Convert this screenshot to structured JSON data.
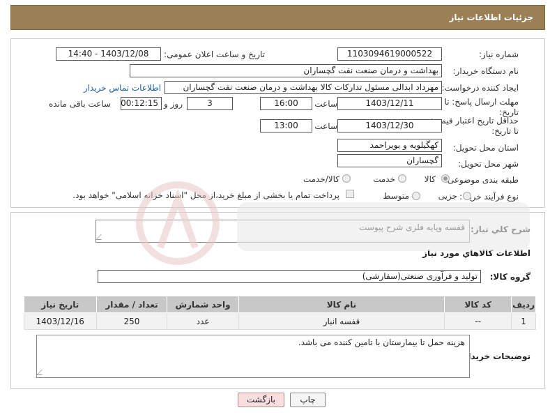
{
  "header": {
    "title": "جزئیات اطلاعات نیاز"
  },
  "form": {
    "need_number_label": "شماره نیاز:",
    "need_number": "1103094619000522",
    "announce_label": "تاریخ و ساعت اعلان عمومی:",
    "announce_value": "1403/12/08 - 14:40",
    "buyer_org_label": "نام دستگاه خریدار:",
    "buyer_org": "بهداشت و درمان صنعت نفت گچساران",
    "creator_label": "ایجاد کننده درخواست:",
    "creator": "مهرداد ابدالی مسئول تدارکات کالا  بهداشت و درمان صنعت نفت گچساران",
    "contact_link": "اطلاعات تماس خریدار",
    "deadline_label": "مهلت ارسال پاسخ: تا تاریخ:",
    "deadline_date": "1403/12/11",
    "time_label": "ساعت",
    "deadline_time": "16:00",
    "days_value": "3",
    "days_label": "روز و",
    "remaining_time": "00:12:15",
    "remaining_label": "ساعت باقی مانده",
    "validity_label": "حداقل تاریخ اعتبار قیمت: تا تاریخ:",
    "validity_date": "1403/12/30",
    "validity_time": "13:00",
    "province_label": "استان محل تحویل:",
    "province": "کهگیلویه و بویراحمد",
    "city_label": "شهر محل تحویل:",
    "city": "گچساران",
    "category_label": "طبقه بندی موضوعی:",
    "category_options": [
      "کالا",
      "خدمت",
      "کالا/خدمت"
    ],
    "process_label": "نوع فرآیند خرید :",
    "process_options": [
      "جزیی",
      "متوسط"
    ],
    "payment_note": "پرداخت تمام یا بخشی از مبلغ خرید،از محل \"اسناد خزانه اسلامی\" خواهد بود."
  },
  "description": {
    "label": "شرح کلي نياز:",
    "value": "قفسه وپایه فلزی شرح پیوست"
  },
  "goods": {
    "section_title": "اطلاعات کالاهاي مورد نياز",
    "group_label": "گروه کالا:",
    "group_value": "تولید و فرآوری صنعتی(سفارشی)",
    "columns": [
      "رديف",
      "کد کالا",
      "نام کالا",
      "واحد شمارش",
      "تعداد / مقدار",
      "تاريخ نياز"
    ],
    "rows": [
      [
        "1",
        "--",
        "قفسه انبار",
        "عدد",
        "250",
        "1403/12/16"
      ]
    ]
  },
  "buyer_notes": {
    "label": "توضيحات خريدار:",
    "value": "هزینه حمل تا بیمارستان با تامین کننده می باشد."
  },
  "buttons": {
    "print": "چاپ",
    "back": "بازگشت"
  },
  "colors": {
    "header": "#9a8054",
    "link": "#1a5dab",
    "back_button": "#f8dede"
  }
}
